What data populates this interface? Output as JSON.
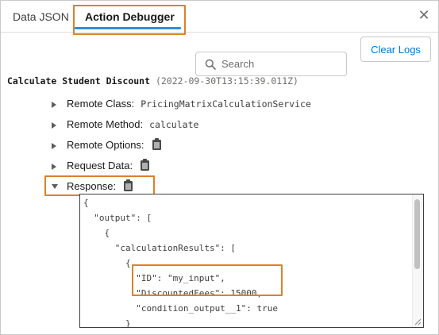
{
  "tabs": [
    {
      "label": "Data JSON"
    },
    {
      "label": "Action Debugger"
    }
  ],
  "accent_colors": {
    "tab_underline": "#2e8ee0",
    "highlight": "#d9822b",
    "button_text": "#0176d3"
  },
  "icons": [
    "close-icon",
    "search-icon",
    "expand-icon",
    "clipboard-icon"
  ],
  "search": {
    "placeholder": "Search",
    "value": ""
  },
  "toolbar": {
    "clear_logs_label": "Clear Logs"
  },
  "log_entry": {
    "prefix": "",
    "title": "Calculate Student Discount",
    "timestamp": "(2022-09-30T13:15:39.011Z)"
  },
  "details": [
    {
      "label": "Remote Class:",
      "value": "PricingMatrixCalculationService"
    },
    {
      "label": "Remote Method:",
      "value": "calculate"
    },
    {
      "label": "Remote Options:",
      "value": ""
    },
    {
      "label": "Request Data:",
      "value": ""
    },
    {
      "label": "Response:",
      "value": ""
    }
  ],
  "response_lines": [
    "{",
    "  \"output\": [",
    "    {",
    "      \"calculationResults\": [",
    "        {",
    "          \"ID\": \"my_input\",",
    "          \"DiscountedFees\": 15000,",
    "          \"condition_output__1\": true",
    "        }"
  ]
}
